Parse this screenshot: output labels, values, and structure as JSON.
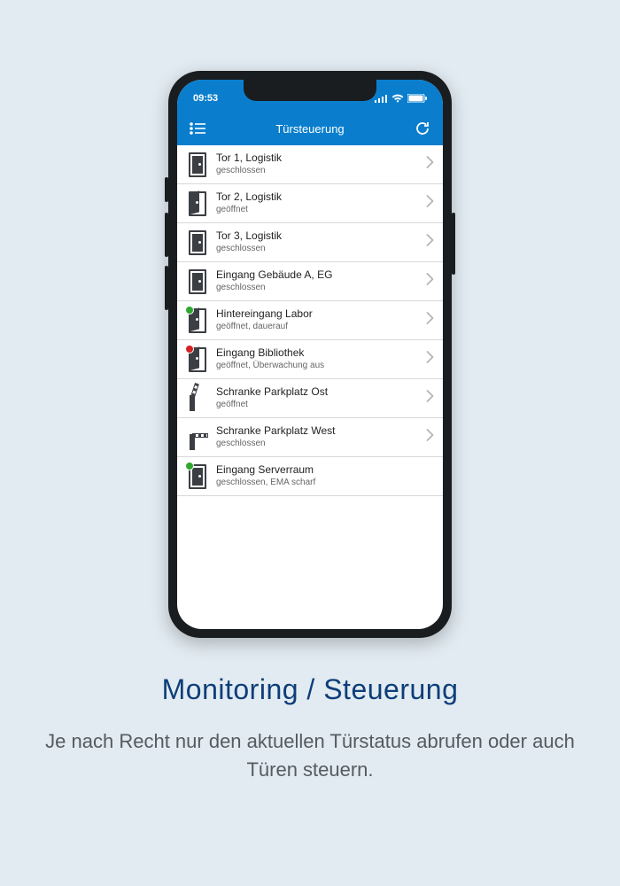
{
  "statusbar": {
    "time": "09:53"
  },
  "navbar": {
    "title": "Türsteuerung"
  },
  "rows": [
    {
      "icon": "door-closed",
      "badge": null,
      "title": "Tor 1, Logistik",
      "status": "geschlossen",
      "chevron": true
    },
    {
      "icon": "door-open",
      "badge": null,
      "title": "Tor 2, Logistik",
      "status": "geöffnet",
      "chevron": true
    },
    {
      "icon": "door-closed",
      "badge": null,
      "title": "Tor 3, Logistik",
      "status": "geschlossen",
      "chevron": true
    },
    {
      "icon": "door-closed",
      "badge": null,
      "title": "Eingang Gebäude A, EG",
      "status": "geschlossen",
      "chevron": true
    },
    {
      "icon": "door-open",
      "badge": "green",
      "title": "Hintereingang Labor",
      "status": "geöffnet, dauerauf",
      "chevron": true
    },
    {
      "icon": "door-open",
      "badge": "red",
      "title": "Eingang Bibliothek",
      "status": "geöffnet, Überwachung aus",
      "chevron": true
    },
    {
      "icon": "barrier-open",
      "badge": null,
      "title": "Schranke Parkplatz Ost",
      "status": "geöffnet",
      "chevron": true
    },
    {
      "icon": "barrier-closed",
      "badge": null,
      "title": "Schranke Parkplatz West",
      "status": "geschlossen",
      "chevron": true
    },
    {
      "icon": "door-closed",
      "badge": "green",
      "title": "Eingang Serverraum",
      "status": "geschlossen, EMA scharf",
      "chevron": false
    }
  ],
  "caption": {
    "heading": "Monitoring / Steuerung",
    "body": "Je nach Recht nur den aktuellen Türstatus abrufen oder auch Türen steuern."
  }
}
